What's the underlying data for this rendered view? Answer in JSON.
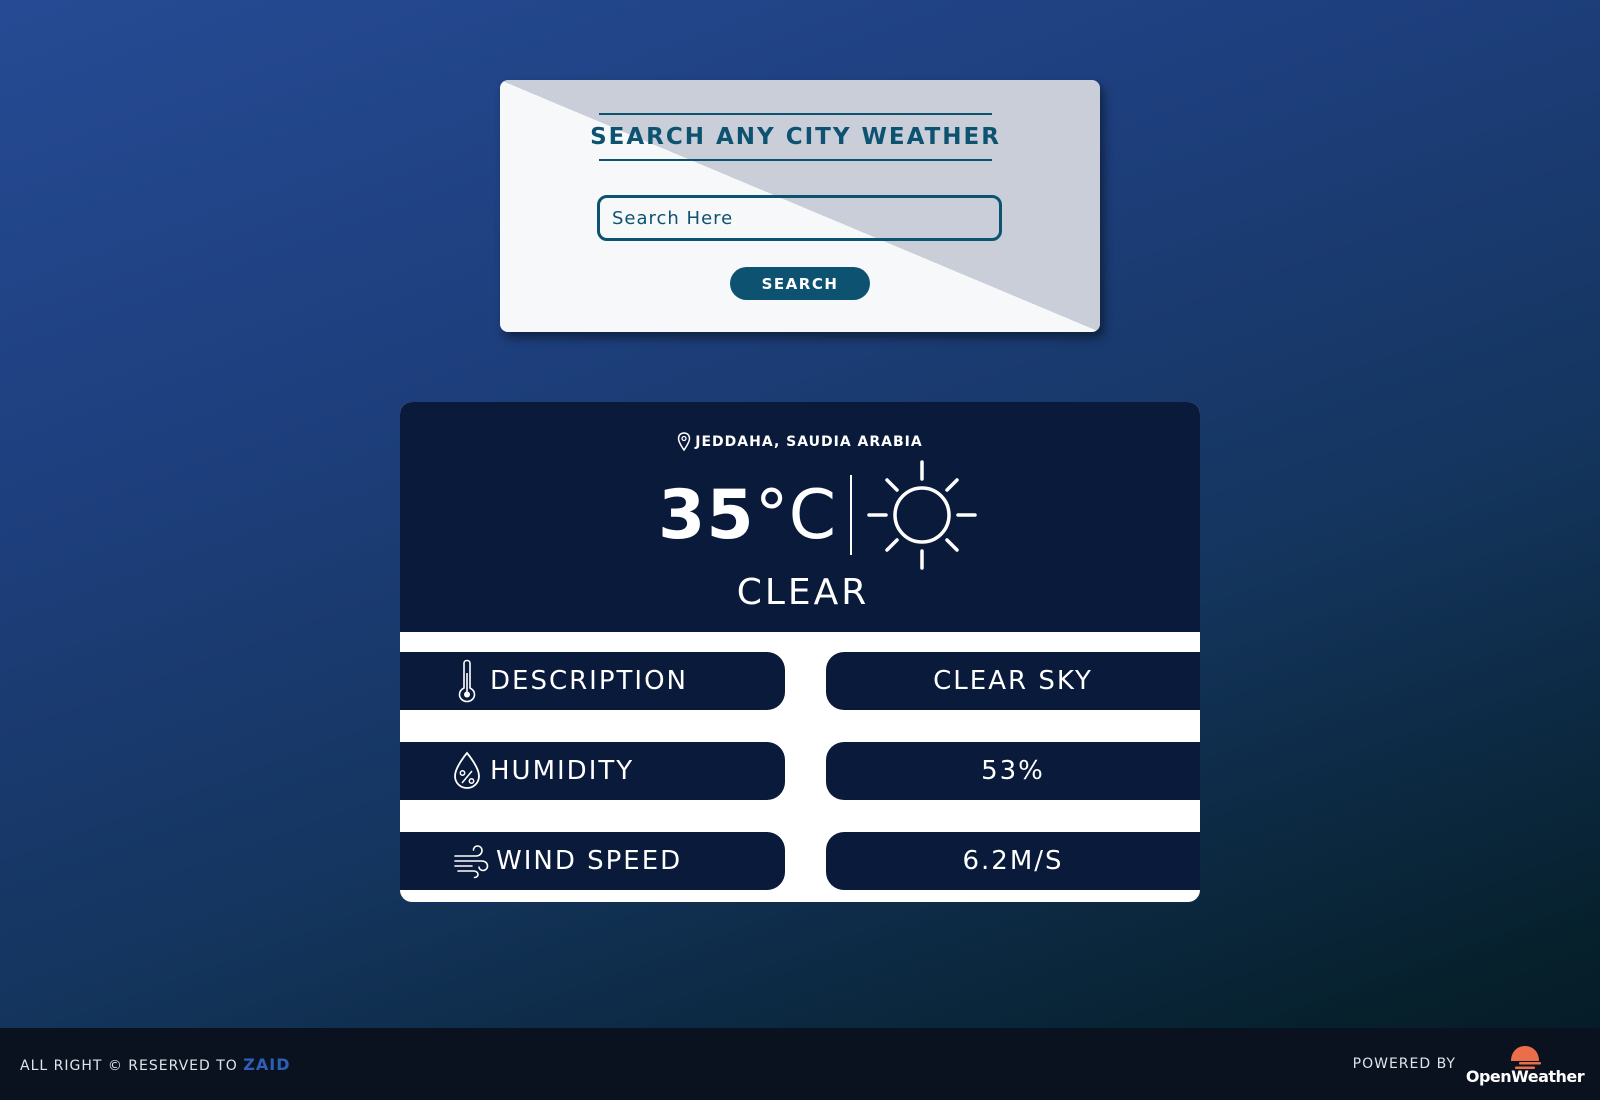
{
  "search": {
    "title": "SEARCH ANY CITY WEATHER",
    "placeholder": "Search Here",
    "value": "",
    "button_label": "SEARCH"
  },
  "weather": {
    "location": "JEDDAHA, SAUDIA ARABIA",
    "temperature": "35",
    "unit": "°C",
    "condition": "CLEAR",
    "condition_icon": "sun-icon",
    "details": [
      {
        "label": "DESCRIPTION",
        "icon": "thermometer-icon",
        "value": "CLEAR SKY"
      },
      {
        "label": "HUMIDITY",
        "icon": "humidity-drop-icon",
        "value": "53%"
      },
      {
        "label": "WIND SPEED",
        "icon": "wind-icon",
        "value": "6.2M/S"
      }
    ]
  },
  "footer": {
    "rights_text": "ALL RIGHT © RESERVED TO",
    "author": "ZAID",
    "powered_by": "POWERED BY",
    "provider": "OpenWeather"
  },
  "colors": {
    "accent": "#0d5270",
    "card_dark": "#0a1a3a",
    "author_link": "#2e5fb7",
    "logo_orange": "#eb6e4b"
  }
}
